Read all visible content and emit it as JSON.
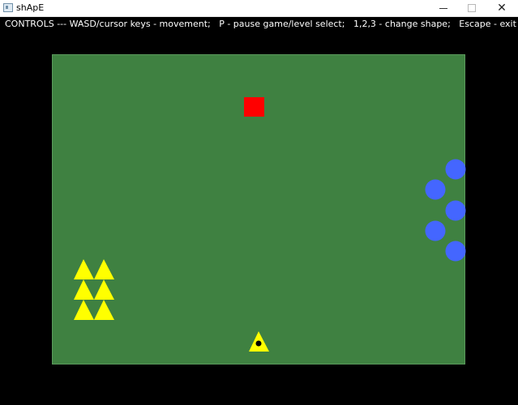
{
  "window": {
    "title": "shApE",
    "icon": "app-window-icon",
    "close_glyph": "✕"
  },
  "controls_text": "CONTROLS --- WASD/cursor keys - movement;   P - pause game/level select;   1,2,3 - change shape;   Escape - exit game",
  "colors": {
    "background": "#000000",
    "playfield": "#3f8141",
    "square": "#ff0000",
    "circle": "#4466ff",
    "triangle": "#ffff00",
    "player_dot": "#000000"
  },
  "icons": {
    "minimize": "minimize-icon",
    "maximize": "maximize-icon",
    "close": "close-icon"
  }
}
